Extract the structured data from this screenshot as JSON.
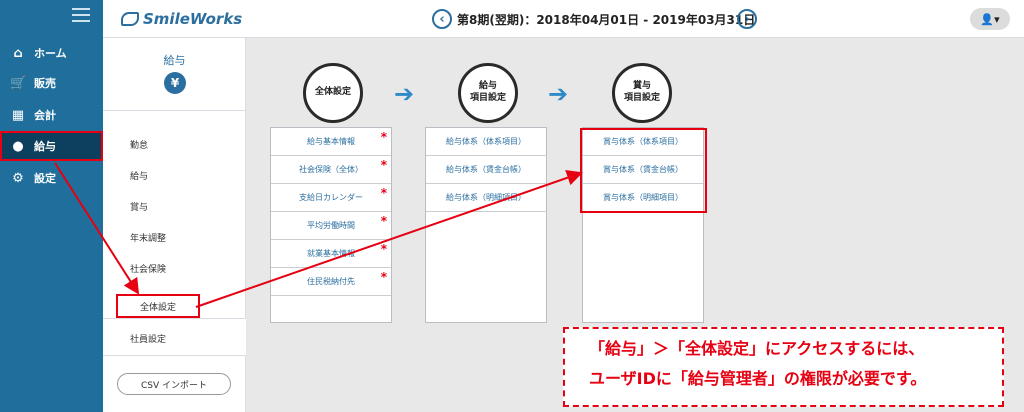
{
  "sidebar": {
    "items": [
      {
        "icon": "home-icon",
        "glyph": "⌂",
        "label": "ホーム"
      },
      {
        "icon": "cart-icon",
        "glyph": "🛒",
        "label": "販売"
      },
      {
        "icon": "calculator-icon",
        "glyph": "▦",
        "label": "会計"
      },
      {
        "icon": "money-bag-icon",
        "glyph": "●",
        "label": "給与"
      },
      {
        "icon": "gear-icon",
        "glyph": "⚙",
        "label": "設定"
      }
    ]
  },
  "header": {
    "logo": "SmileWorks",
    "period": "第8期(翌期)：2018年04月01日 - 2019年03月31日",
    "prev_glyph": "‹",
    "next_glyph": "›",
    "user_glyph": "👤▾"
  },
  "submenu": {
    "title": "給与",
    "icon_glyph": "¥",
    "items": [
      "勤怠",
      "給与",
      "賞与",
      "年末調整",
      "社会保険",
      "全体設定",
      "社員設定"
    ],
    "csv_button": "CSV インポート"
  },
  "flow": {
    "steps": [
      "全体設定",
      "給与\n項目設定",
      "賞与\n項目設定"
    ],
    "arrow_glyph": "➔",
    "col1": [
      "給与基本情報",
      "社会保険（全体）",
      "支給日カレンダー",
      "平均労働時間",
      "就業基本情報",
      "住民税納付先"
    ],
    "col1_required_mark": "*",
    "col2": [
      "給与体系（体系項目）",
      "給与体系（賃金台帳）",
      "給与体系（明細項目）"
    ],
    "col3": [
      "賞与体系（体系項目）",
      "賞与体系（賃金台帳）",
      "賞与体系（明細項目）"
    ]
  },
  "note": {
    "line1": "「給与」＞「全体設定」にアクセスするには、",
    "line2": "ユーザIDに「給与管理者」の権限が必要です。"
  },
  "colors": {
    "sidebar": "#1f6e9b",
    "accent": "#2b6fa0",
    "highlight": "#e60012",
    "arrow": "#2f8bc8"
  }
}
